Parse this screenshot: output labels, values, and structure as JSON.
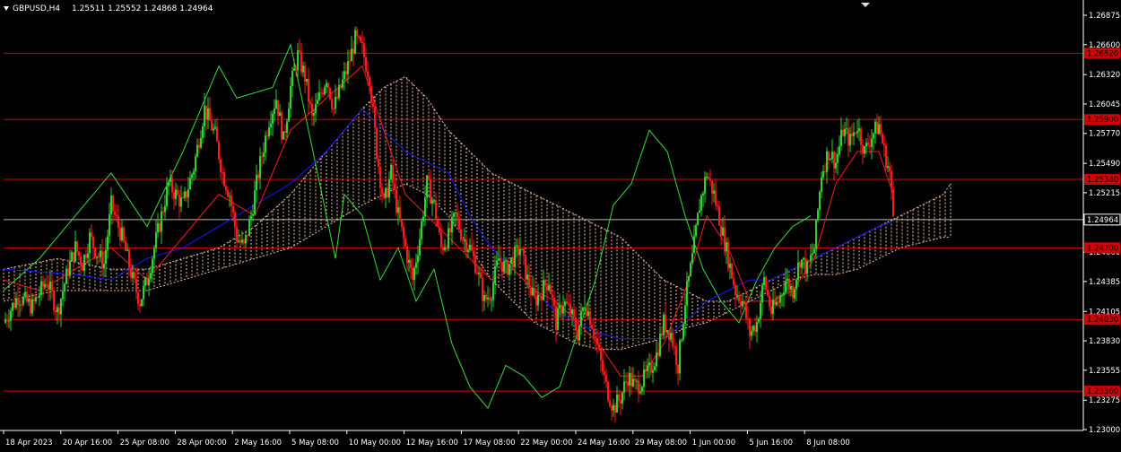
{
  "chart_data": {
    "type": "candlestick",
    "symbol_label": "GBPUSD,H4",
    "ohlc_label": "1.25511 1.25552 1.24868 1.24964",
    "ylim": [
      1.23,
      1.2694
    ],
    "price_ticks": [
      "1.26875",
      "1.26600",
      "1.26320",
      "1.26045",
      "1.25770",
      "1.25490",
      "1.25215",
      "1.24935",
      "1.24660",
      "1.24385",
      "1.24105",
      "1.23830",
      "1.23555",
      "1.23275",
      "1.23000"
    ],
    "time_labels": [
      "18 Apr 2023",
      "20 Apr 16:00",
      "25 Apr 08:00",
      "28 Apr 00:00",
      "2 May 16:00",
      "5 May 08:00",
      "10 May 00:00",
      "12 May 16:00",
      "17 May 08:00",
      "22 May 00:00",
      "24 May 16:00",
      "29 May 08:00",
      "1 Jun 00:00",
      "5 Jun 16:00",
      "8 Jun 08:00"
    ],
    "current_price": "1.24964",
    "current_price_value": 1.24964,
    "levels": [
      {
        "label": "1.26520",
        "value": 1.2652
      },
      {
        "label": "1.25900",
        "value": 1.259
      },
      {
        "label": "1.25340",
        "value": 1.2534
      },
      {
        "label": "1.24700",
        "value": 1.247
      },
      {
        "label": "1.24030",
        "value": 1.2403
      },
      {
        "label": "1.23360",
        "value": 1.2336
      }
    ],
    "price_path": [
      [
        0,
        1.24
      ],
      [
        8,
        1.2425
      ],
      [
        16,
        1.2415
      ],
      [
        24,
        1.244
      ],
      [
        30,
        1.241
      ],
      [
        36,
        1.245
      ],
      [
        40,
        1.247
      ],
      [
        44,
        1.2455
      ],
      [
        48,
        1.248
      ],
      [
        52,
        1.2465
      ],
      [
        56,
        1.2455
      ],
      [
        60,
        1.251
      ],
      [
        66,
        1.248
      ],
      [
        72,
        1.244
      ],
      [
        76,
        1.242
      ],
      [
        80,
        1.244
      ],
      [
        84,
        1.247
      ],
      [
        88,
        1.25
      ],
      [
        92,
        1.253
      ],
      [
        100,
        1.251
      ],
      [
        106,
        1.2545
      ],
      [
        112,
        1.26
      ],
      [
        118,
        1.2575
      ],
      [
        122,
        1.254
      ],
      [
        126,
        1.252
      ],
      [
        130,
        1.248
      ],
      [
        134,
        1.247
      ],
      [
        138,
        1.25
      ],
      [
        142,
        1.254
      ],
      [
        148,
        1.259
      ],
      [
        152,
        1.261
      ],
      [
        156,
        1.257
      ],
      [
        160,
        1.262
      ],
      [
        164,
        1.265
      ],
      [
        168,
        1.263
      ],
      [
        172,
        1.259
      ],
      [
        176,
        1.261
      ],
      [
        180,
        1.263
      ],
      [
        184,
        1.26
      ],
      [
        188,
        1.262
      ],
      [
        192,
        1.264
      ],
      [
        196,
        1.2665
      ],
      [
        200,
        1.2655
      ],
      [
        204,
        1.263
      ],
      [
        208,
        1.256
      ],
      [
        212,
        1.251
      ],
      [
        216,
        1.254
      ],
      [
        220,
        1.25
      ],
      [
        224,
        1.247
      ],
      [
        228,
        1.244
      ],
      [
        232,
        1.248
      ],
      [
        236,
        1.253
      ],
      [
        240,
        1.251
      ],
      [
        244,
        1.247
      ],
      [
        248,
        1.248
      ],
      [
        252,
        1.25
      ],
      [
        256,
        1.248
      ],
      [
        260,
        1.247
      ],
      [
        264,
        1.245
      ],
      [
        268,
        1.242
      ],
      [
        272,
        1.243
      ],
      [
        276,
        1.246
      ],
      [
        280,
        1.245
      ],
      [
        284,
        1.246
      ],
      [
        288,
        1.247
      ],
      [
        292,
        1.244
      ],
      [
        296,
        1.242
      ],
      [
        300,
        1.243
      ],
      [
        304,
        1.244
      ],
      [
        308,
        1.24
      ],
      [
        312,
        1.242
      ],
      [
        316,
        1.241
      ],
      [
        320,
        1.239
      ],
      [
        324,
        1.242
      ],
      [
        328,
        1.24
      ],
      [
        332,
        1.237
      ],
      [
        336,
        1.234
      ],
      [
        340,
        1.232
      ],
      [
        344,
        1.233
      ],
      [
        348,
        1.235
      ],
      [
        352,
        1.234
      ],
      [
        356,
        1.2345
      ],
      [
        360,
        1.2355
      ],
      [
        364,
        1.237
      ],
      [
        368,
        1.24
      ],
      [
        372,
        1.239
      ],
      [
        376,
        1.236
      ],
      [
        380,
        1.242
      ],
      [
        384,
        1.246
      ],
      [
        388,
        1.251
      ],
      [
        392,
        1.254
      ],
      [
        396,
        1.252
      ],
      [
        400,
        1.249
      ],
      [
        404,
        1.246
      ],
      [
        408,
        1.243
      ],
      [
        412,
        1.242
      ],
      [
        416,
        1.239
      ],
      [
        420,
        1.24
      ],
      [
        424,
        1.244
      ],
      [
        428,
        1.241
      ],
      [
        432,
        1.242
      ],
      [
        436,
        1.244
      ],
      [
        440,
        1.243
      ],
      [
        444,
        1.246
      ],
      [
        448,
        1.245
      ],
      [
        452,
        1.247
      ],
      [
        456,
        1.254
      ],
      [
        460,
        1.256
      ],
      [
        464,
        1.255
      ],
      [
        468,
        1.258
      ],
      [
        472,
        1.257
      ],
      [
        476,
        1.2585
      ],
      [
        480,
        1.256
      ],
      [
        484,
        1.2575
      ],
      [
        488,
        1.2585
      ],
      [
        491,
        1.256
      ],
      [
        494,
        1.254
      ],
      [
        496,
        1.25
      ]
    ],
    "tenkan_path": [
      [
        0,
        1.244
      ],
      [
        20,
        1.243
      ],
      [
        40,
        1.245
      ],
      [
        60,
        1.247
      ],
      [
        80,
        1.244
      ],
      [
        100,
        1.248
      ],
      [
        120,
        1.252
      ],
      [
        140,
        1.25
      ],
      [
        160,
        1.258
      ],
      [
        180,
        1.261
      ],
      [
        200,
        1.264
      ],
      [
        212,
        1.258
      ],
      [
        224,
        1.252
      ],
      [
        236,
        1.25
      ],
      [
        248,
        1.248
      ],
      [
        260,
        1.246
      ],
      [
        272,
        1.244
      ],
      [
        284,
        1.245
      ],
      [
        296,
        1.243
      ],
      [
        308,
        1.242
      ],
      [
        320,
        1.24
      ],
      [
        332,
        1.238
      ],
      [
        344,
        1.235
      ],
      [
        356,
        1.235
      ],
      [
        368,
        1.238
      ],
      [
        380,
        1.243
      ],
      [
        392,
        1.25
      ],
      [
        404,
        1.247
      ],
      [
        416,
        1.242
      ],
      [
        428,
        1.242
      ],
      [
        440,
        1.243
      ],
      [
        452,
        1.246
      ],
      [
        464,
        1.253
      ],
      [
        476,
        1.256
      ],
      [
        488,
        1.256
      ],
      [
        496,
        1.252
      ]
    ],
    "kijun_path": [
      [
        0,
        1.245
      ],
      [
        40,
        1.2445
      ],
      [
        60,
        1.244
      ],
      [
        80,
        1.246
      ],
      [
        100,
        1.247
      ],
      [
        120,
        1.249
      ],
      [
        140,
        1.251
      ],
      [
        160,
        1.253
      ],
      [
        180,
        1.256
      ],
      [
        200,
        1.26
      ],
      [
        212,
        1.258
      ],
      [
        224,
        1.256
      ],
      [
        236,
        1.255
      ],
      [
        248,
        1.254
      ],
      [
        260,
        1.25
      ],
      [
        272,
        1.247
      ],
      [
        284,
        1.245
      ],
      [
        296,
        1.243
      ],
      [
        308,
        1.241
      ],
      [
        320,
        1.24
      ],
      [
        332,
        1.239
      ],
      [
        344,
        1.2385
      ],
      [
        356,
        1.2385
      ],
      [
        368,
        1.2385
      ],
      [
        380,
        1.24
      ],
      [
        392,
        1.242
      ],
      [
        404,
        1.243
      ],
      [
        416,
        1.244
      ],
      [
        428,
        1.244
      ],
      [
        440,
        1.245
      ],
      [
        452,
        1.246
      ],
      [
        464,
        1.247
      ],
      [
        476,
        1.248
      ],
      [
        488,
        1.249
      ],
      [
        496,
        1.2495
      ]
    ],
    "chikou_path": [
      [
        0,
        1.243
      ],
      [
        20,
        1.246
      ],
      [
        40,
        1.25
      ],
      [
        60,
        1.254
      ],
      [
        80,
        1.249
      ],
      [
        100,
        1.256
      ],
      [
        120,
        1.264
      ],
      [
        130,
        1.261
      ],
      [
        150,
        1.262
      ],
      [
        160,
        1.266
      ],
      [
        175,
        1.254
      ],
      [
        185,
        1.246
      ],
      [
        190,
        1.252
      ],
      [
        200,
        1.25
      ],
      [
        210,
        1.244
      ],
      [
        220,
        1.247
      ],
      [
        230,
        1.242
      ],
      [
        240,
        1.245
      ],
      [
        250,
        1.238
      ],
      [
        260,
        1.234
      ],
      [
        270,
        1.232
      ],
      [
        280,
        1.236
      ],
      [
        290,
        1.235
      ],
      [
        300,
        1.233
      ],
      [
        310,
        1.234
      ],
      [
        320,
        1.239
      ],
      [
        330,
        1.244
      ],
      [
        340,
        1.251
      ],
      [
        350,
        1.253
      ],
      [
        360,
        1.258
      ],
      [
        370,
        1.256
      ],
      [
        380,
        1.25
      ],
      [
        390,
        1.245
      ],
      [
        400,
        1.242
      ],
      [
        410,
        1.24
      ],
      [
        420,
        1.244
      ],
      [
        430,
        1.247
      ],
      [
        440,
        1.249
      ],
      [
        450,
        1.25
      ]
    ],
    "cloud_top": [
      [
        0,
        1.245
      ],
      [
        30,
        1.246
      ],
      [
        60,
        1.245
      ],
      [
        80,
        1.245
      ],
      [
        100,
        1.246
      ],
      [
        120,
        1.247
      ],
      [
        140,
        1.249
      ],
      [
        160,
        1.252
      ],
      [
        180,
        1.256
      ],
      [
        200,
        1.26
      ],
      [
        212,
        1.262
      ],
      [
        224,
        1.263
      ],
      [
        236,
        1.261
      ],
      [
        248,
        1.258
      ],
      [
        260,
        1.256
      ],
      [
        272,
        1.254
      ],
      [
        284,
        1.253
      ],
      [
        296,
        1.252
      ],
      [
        308,
        1.251
      ],
      [
        320,
        1.25
      ],
      [
        332,
        1.249
      ],
      [
        344,
        1.248
      ],
      [
        356,
        1.246
      ],
      [
        368,
        1.244
      ],
      [
        380,
        1.243
      ],
      [
        392,
        1.242
      ],
      [
        404,
        1.242
      ],
      [
        416,
        1.243
      ],
      [
        428,
        1.244
      ],
      [
        440,
        1.245
      ],
      [
        452,
        1.246
      ],
      [
        464,
        1.247
      ],
      [
        476,
        1.248
      ],
      [
        488,
        1.249
      ],
      [
        500,
        1.25
      ],
      [
        512,
        1.251
      ],
      [
        524,
        1.252
      ],
      [
        528,
        1.253
      ]
    ],
    "cloud_bottom": [
      [
        0,
        1.242
      ],
      [
        30,
        1.243
      ],
      [
        60,
        1.243
      ],
      [
        80,
        1.243
      ],
      [
        100,
        1.244
      ],
      [
        120,
        1.245
      ],
      [
        140,
        1.246
      ],
      [
        160,
        1.247
      ],
      [
        180,
        1.249
      ],
      [
        200,
        1.251
      ],
      [
        212,
        1.252
      ],
      [
        224,
        1.253
      ],
      [
        236,
        1.252
      ],
      [
        248,
        1.25
      ],
      [
        260,
        1.247
      ],
      [
        272,
        1.244
      ],
      [
        284,
        1.242
      ],
      [
        296,
        1.24
      ],
      [
        308,
        1.239
      ],
      [
        320,
        1.238
      ],
      [
        332,
        1.2375
      ],
      [
        344,
        1.2375
      ],
      [
        356,
        1.238
      ],
      [
        368,
        1.2385
      ],
      [
        380,
        1.2395
      ],
      [
        392,
        1.24
      ],
      [
        404,
        1.241
      ],
      [
        416,
        1.242
      ],
      [
        428,
        1.243
      ],
      [
        440,
        1.244
      ],
      [
        452,
        1.2445
      ],
      [
        464,
        1.2445
      ],
      [
        476,
        1.245
      ],
      [
        488,
        1.246
      ],
      [
        500,
        1.247
      ],
      [
        512,
        1.2475
      ],
      [
        524,
        1.248
      ],
      [
        528,
        1.248
      ]
    ],
    "colors": {
      "background": "#000000",
      "bull": "#2fd02f",
      "bear": "#ff1a1a",
      "level": "#d40000",
      "current": "#ffffff",
      "tenkan": "#ff1a1a",
      "kijun": "#1a1aff",
      "chikou": "#33dd33",
      "cloud": "#f5c6a0",
      "axis_text": "#ffffff"
    }
  }
}
